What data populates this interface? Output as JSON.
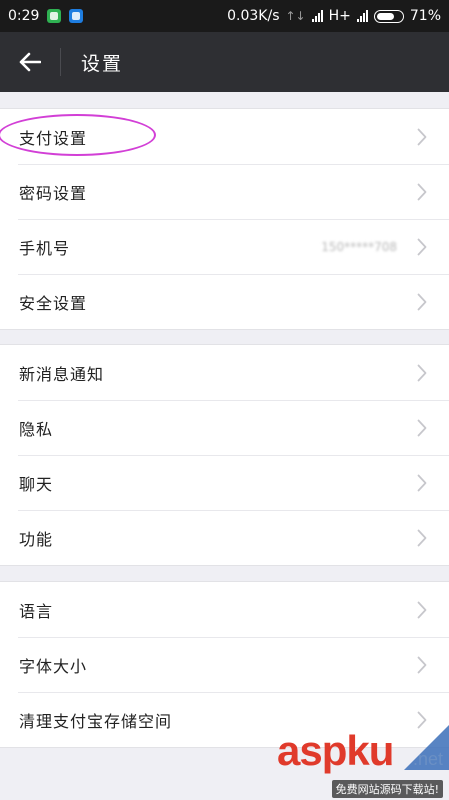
{
  "status_bar": {
    "time": "0:29",
    "network_speed": "0.03K/s",
    "data_arrows": "↑↓",
    "network_type": "H+",
    "battery_percent": "71%",
    "battery_level": 0.71,
    "notification_icons": [
      "green-shield-icon",
      "blue-app-icon"
    ]
  },
  "header": {
    "back_icon": "back-arrow-icon",
    "title": "设置"
  },
  "groups": [
    {
      "items": [
        {
          "label": "支付设置",
          "highlighted": true
        },
        {
          "label": "密码设置"
        },
        {
          "label": "手机号",
          "value": "150*****708"
        },
        {
          "label": "安全设置"
        }
      ]
    },
    {
      "items": [
        {
          "label": "新消息通知"
        },
        {
          "label": "隐私"
        },
        {
          "label": "聊天"
        },
        {
          "label": "功能"
        }
      ]
    },
    {
      "items": [
        {
          "label": "语言"
        },
        {
          "label": "字体大小"
        },
        {
          "label": "清理支付宝存储空间"
        }
      ]
    }
  ],
  "watermark": {
    "brand": "aspku",
    "tld": ".net",
    "tagline": "免费网站源码下载站!"
  },
  "colors": {
    "status_bar_bg": "#1a1a1a",
    "header_bg": "#2e2f33",
    "page_bg": "#efeff4",
    "highlight_ring": "#d23fd6",
    "chevron": "#c7c7cc"
  }
}
